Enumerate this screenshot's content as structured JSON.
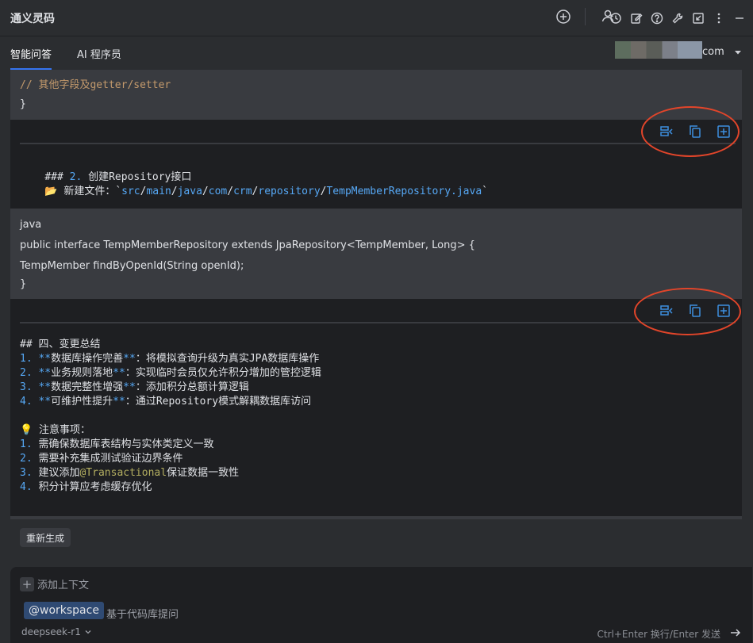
{
  "header": {
    "title": "通义灵码",
    "icons": [
      "history-icon",
      "edit-icon",
      "help-icon",
      "wrench-icon",
      "collapse-icon",
      "more-icon",
      "minimize-icon"
    ]
  },
  "tabs": [
    {
      "label": "智能问答",
      "active": true
    },
    {
      "label": "AI 程序员",
      "active": false
    }
  ],
  "user": {
    "email_suffix": "com"
  },
  "content": {
    "code1": {
      "comment": "// 其他字段及getter/setter",
      "close": "}"
    },
    "section2": {
      "heading_prefix": "### ",
      "heading_num": "2.",
      "heading_text": " 创建Repository接口",
      "newfile_icon": "📂",
      "newfile_label": " 新建文件：`",
      "path_segments": [
        "src",
        "/",
        "main",
        "/",
        "java",
        "/",
        "com",
        "/",
        "crm",
        "/",
        "repository",
        "/",
        "TempMemberRepository.java"
      ],
      "newfile_end": "`"
    },
    "code2": {
      "lang": "java",
      "line1": "public interface TempMemberRepository extends JpaRepository<TempMember, Long> {",
      "line2": "TempMember findByOpenId(String openId);",
      "close": "}"
    },
    "summary": {
      "heading": "## 四、变更总结",
      "items": [
        {
          "num": "1.",
          "bold": "数据库操作完善",
          "text": "：将模拟查询升级为真实JPA数据库操作"
        },
        {
          "num": "2.",
          "bold": "业务规则落地",
          "text": "：实现临时会员仅允许积分增加的管控逻辑"
        },
        {
          "num": "3.",
          "bold": "数据完整性增强",
          "text": "：添加积分总额计算逻辑"
        },
        {
          "num": "4.",
          "bold": "可维护性提升",
          "text": "：通过Repository模式解耦数据库访问"
        }
      ]
    },
    "notes": {
      "icon": "💡",
      "heading": " 注意事项：",
      "items": [
        {
          "num": "1.",
          "text": " 需确保数据库表结构与实体类定义一致"
        },
        {
          "num": "2.",
          "text": " 需要补充集成测试验证边界条件"
        },
        {
          "num": "3.",
          "pre": " 建议添加",
          "ann": "@Transactional",
          "post": "保证数据一致性"
        },
        {
          "num": "4.",
          "text": " 积分计算应考虑缓存优化"
        }
      ]
    }
  },
  "actions": {
    "regenerate": "重新生成"
  },
  "input": {
    "add_context": "添加上下文",
    "workspace_chip": "@workspace",
    "workspace_hint": "基于代码库提问",
    "model": "deepseek-r1",
    "send_hint": "Ctrl+Enter 换行/Enter 发送"
  },
  "colors": {
    "accent": "#3574f0",
    "annotation_oval": "#e2452a",
    "toolbar_icon": "#3d8fe0"
  }
}
